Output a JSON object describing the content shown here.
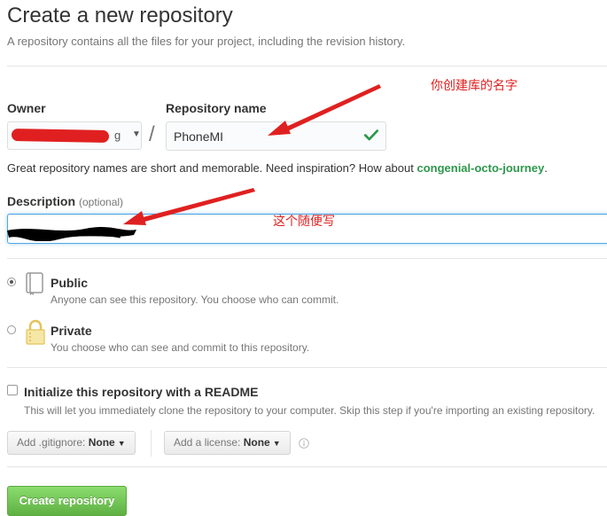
{
  "header": {
    "title": "Create a new repository",
    "subtitle": "A repository contains all the files for your project, including the revision history."
  },
  "owner": {
    "label": "Owner",
    "visible_tail": "g"
  },
  "repo": {
    "label": "Repository name",
    "value": "PhoneMI",
    "separator": "/"
  },
  "hint": {
    "text": "Great repository names are short and memorable. Need inspiration? How about ",
    "suggestion": "congenial-octo-journey",
    "suffix": "."
  },
  "description": {
    "label": "Description",
    "optional": "(optional)"
  },
  "visibility": {
    "public_title": "Public",
    "public_note": "Anyone can see this repository. You choose who can commit.",
    "private_title": "Private",
    "private_note": "You choose who can see and commit to this repository.",
    "selected": "public"
  },
  "readme": {
    "label": "Initialize this repository with a README",
    "note": "This will let you immediately clone the repository to your computer. Skip this step if you're importing an existing repository.",
    "checked": false
  },
  "gitignore": {
    "prefix": "Add .gitignore:",
    "value": "None"
  },
  "license": {
    "prefix": "Add a license:",
    "value": "None"
  },
  "create_button": "Create repository",
  "annotations": {
    "repo_name_note": "你创建库的名字",
    "description_note": "这个随便写",
    "color": "#e02020"
  },
  "colors": {
    "accent_green": "#2c974b",
    "button_green": "#60b044",
    "focus_blue": "#51a7e8"
  }
}
